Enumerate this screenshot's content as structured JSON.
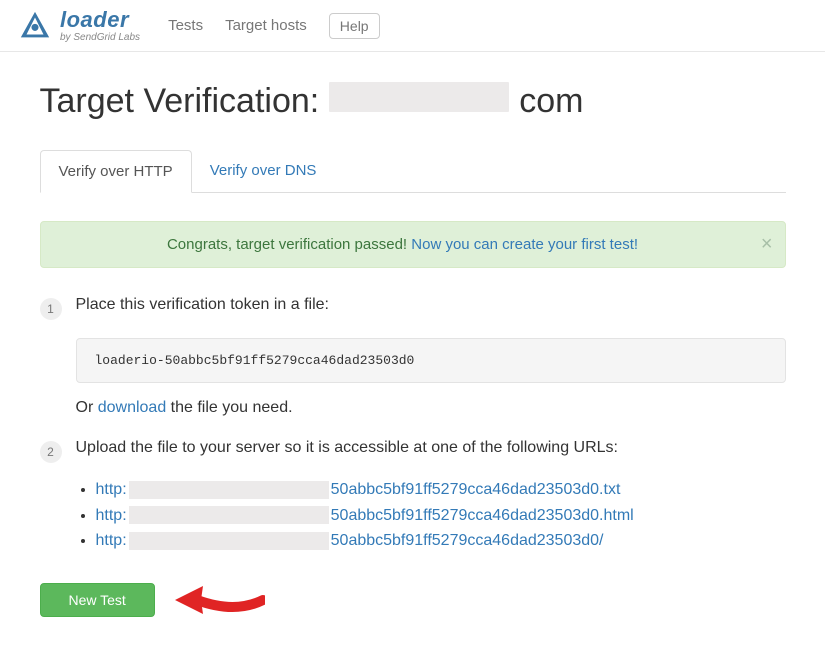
{
  "brand": {
    "title": "loader",
    "subtitle": "by SendGrid Labs"
  },
  "nav": {
    "tests": "Tests",
    "hosts": "Target hosts",
    "help": "Help"
  },
  "page": {
    "heading_prefix": "Target Verification:",
    "heading_suffix": "com"
  },
  "tabs": {
    "http": "Verify over HTTP",
    "dns": "Verify over DNS"
  },
  "alert": {
    "msg": "Congrats, target verification passed!",
    "link": "Now you can create your first test!"
  },
  "steps": {
    "one": {
      "label": "1",
      "text": "Place this verification token in a file:"
    },
    "token": "loaderio-50abbc5bf91ff5279cca46dad23503d0",
    "or_prefix": "Or ",
    "or_link": "download",
    "or_suffix": " the file you need.",
    "two": {
      "label": "2",
      "text": "Upload the file to your server so it is accessible at one of the following URLs:"
    },
    "urls": [
      {
        "proto": "http:",
        "file": "50abbc5bf91ff5279cca46dad23503d0.txt"
      },
      {
        "proto": "http:",
        "file": "50abbc5bf91ff5279cca46dad23503d0.html"
      },
      {
        "proto": "http:",
        "file": "50abbc5bf91ff5279cca46dad23503d0/"
      }
    ]
  },
  "actions": {
    "new_test": "New Test"
  }
}
